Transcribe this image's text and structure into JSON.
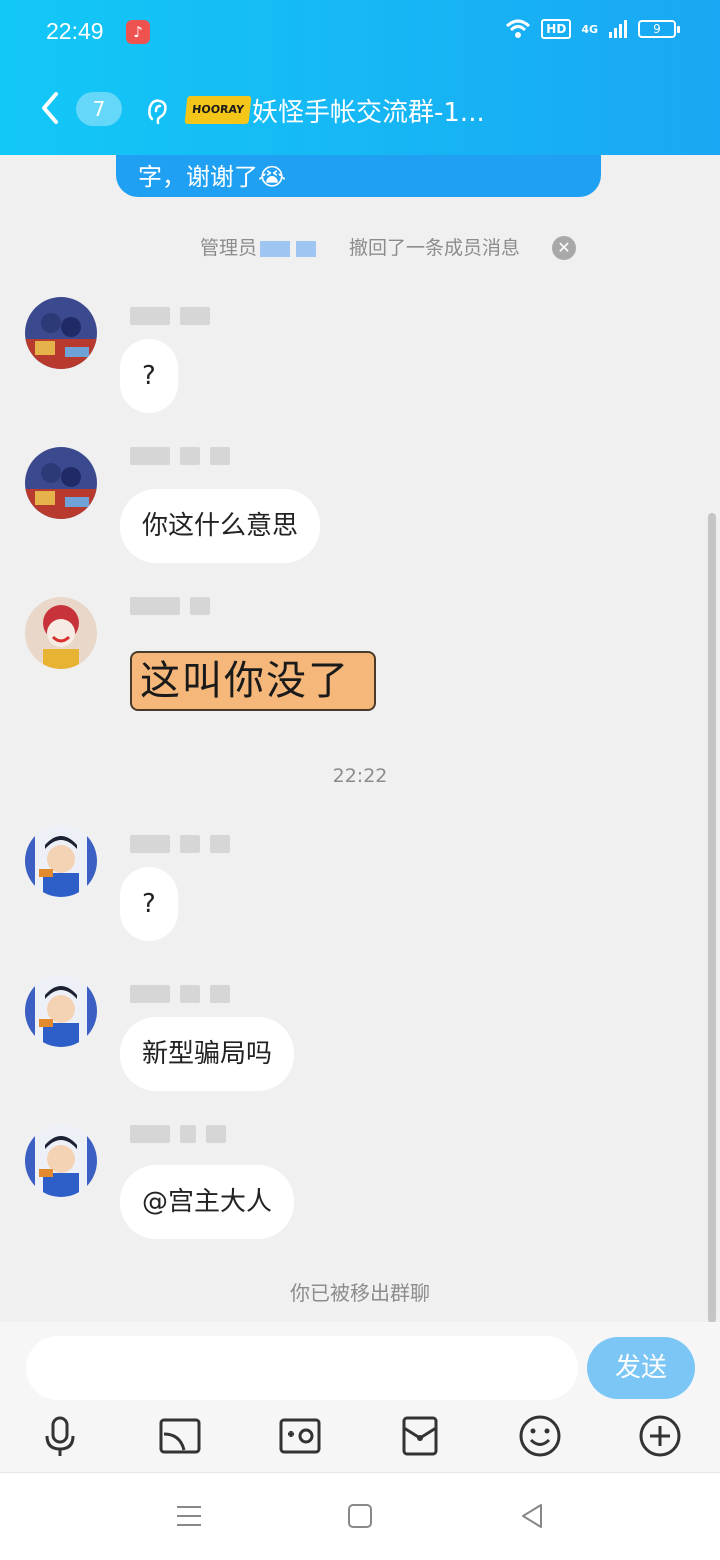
{
  "status": {
    "time": "22:49",
    "hd": "HD",
    "network": "4G",
    "battery": "9"
  },
  "header": {
    "unread_count": "7",
    "logo_text": "HOORAY",
    "title": "妖怪手帐交流群-1..."
  },
  "previous_bubble": {
    "text": "字，谢谢了😭"
  },
  "recall_notice": {
    "prefix": "管理员",
    "suffix": "撤回了一条成员消息"
  },
  "messages": [
    {
      "text": "?"
    },
    {
      "text": "你这什么意思"
    },
    {
      "sticker_text": "这叫你没了"
    },
    {
      "text": "?"
    },
    {
      "text": "新型骗局吗"
    },
    {
      "text": "@宫主大人"
    }
  ],
  "time_divider": "22:22",
  "removed_notice": "你已被移出群聊",
  "input": {
    "value": "",
    "placeholder": ""
  },
  "send_label": "发送",
  "toolbar": [
    "mic-icon",
    "screen-cast-icon",
    "photo-icon",
    "red-packet-icon",
    "emoji-icon",
    "plus-icon"
  ],
  "nav": [
    "menu-icon",
    "home-icon",
    "back-icon"
  ],
  "colors": {
    "header_start": "#12c8f7",
    "header_end": "#1aa7f3",
    "send_button": "#7cc6f6",
    "chat_bg": "#f0f0f0"
  }
}
